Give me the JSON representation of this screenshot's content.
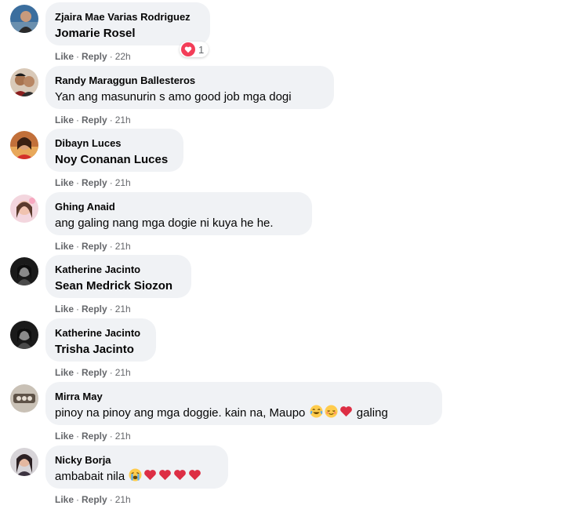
{
  "colors": {
    "bubble": "#f0f2f5",
    "meta_text": "#65676b",
    "heart": "#f33e58"
  },
  "comments": [
    {
      "author": "Zjaira Mae Varias Rodriguez",
      "text": "Jomarie Rosel",
      "is_mention": true,
      "like": "Like",
      "reply": "Reply",
      "time": "22h",
      "reaction": {
        "icon": "heart-reaction-icon",
        "count": "1"
      }
    },
    {
      "author": "Randy Maraggun Ballesteros",
      "text": "Yan ang masunurin s amo good job mga dogi",
      "like": "Like",
      "reply": "Reply",
      "time": "21h"
    },
    {
      "author": "Dibayn Luces",
      "text": "Noy Conanan Luces",
      "is_mention": true,
      "like": "Like",
      "reply": "Reply",
      "time": "21h"
    },
    {
      "author": "Ghing Anaid",
      "text": "ang galing nang mga dogie ni kuya he he.",
      "like": "Like",
      "reply": "Reply",
      "time": "21h"
    },
    {
      "author": "Katherine Jacinto",
      "text": "Sean Medrick Siozon",
      "is_mention": true,
      "like": "Like",
      "reply": "Reply",
      "time": "21h"
    },
    {
      "author": "Katherine Jacinto",
      "text": "Trisha Jacinto",
      "is_mention": true,
      "like": "Like",
      "reply": "Reply",
      "time": "21h"
    },
    {
      "author": "Mirra May",
      "text_before": "pinoy na pinoy ang mga doggie. kain na, Maupo",
      "emojis": [
        "joy-emoji-icon",
        "relieved-emoji-icon",
        "red-heart-emoji-icon"
      ],
      "text_after": "galing",
      "like": "Like",
      "reply": "Reply",
      "time": "21h"
    },
    {
      "author": "Nicky Borja",
      "text_before": "ambabait nila",
      "emojis": [
        "loudly-crying-emoji-icon",
        "red-heart-emoji-icon",
        "red-heart-emoji-icon",
        "red-heart-emoji-icon",
        "red-heart-emoji-icon"
      ],
      "like": "Like",
      "reply": "Reply",
      "time": "21h"
    }
  ]
}
